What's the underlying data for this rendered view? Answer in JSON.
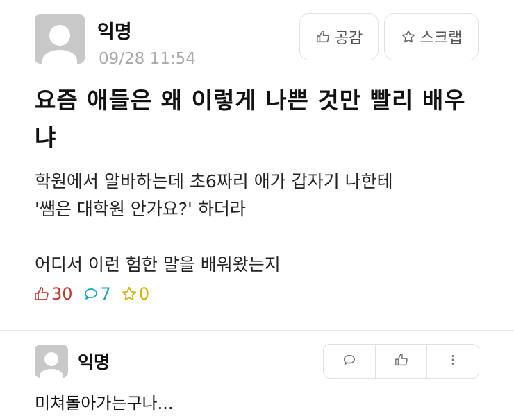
{
  "post": {
    "author": "익명",
    "datetime": "09/28 11:54",
    "like_label": "공감",
    "scrap_label": "스크랩",
    "title": "요즘 애들은 왜 이렇게 나쁜 것만 빨리 배우냐",
    "body_lines": [
      "학원에서 알바하는데 초6짜리 애가 갑자기 나한테",
      "'쌤은 대학원 안가요?' 하더라",
      "어디서 이런 험한 말을 배워왔는지"
    ],
    "stats": {
      "likes": "30",
      "comments": "7",
      "scraps": "0"
    },
    "colors": {
      "likes": "#c1392b",
      "comments": "#17a2b8",
      "scraps": "#d4b000",
      "meta": "#a9a9a9"
    }
  },
  "comment": {
    "author": "익명",
    "text": "미쳐돌아가는구나...",
    "actions": [
      "reply-icon",
      "thumbs-up-icon",
      "more-vertical-icon"
    ]
  }
}
